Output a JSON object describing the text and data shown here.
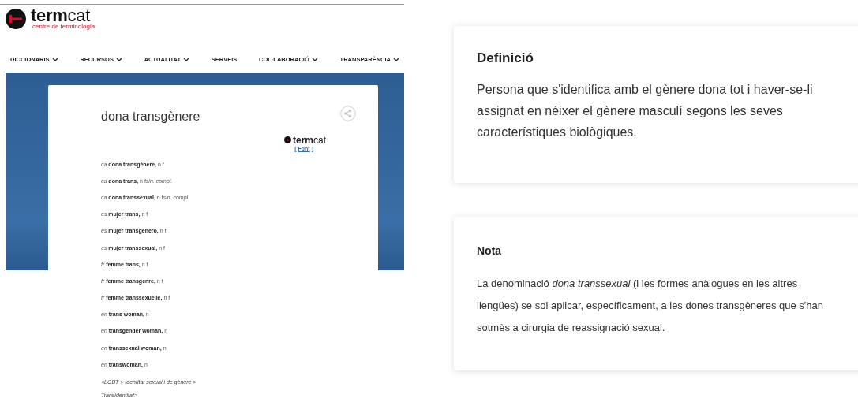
{
  "logo": {
    "name": "**term**cat",
    "tagline": "centre de terminologia"
  },
  "nav": [
    {
      "label": "DICCIONARIS",
      "dropdown": true
    },
    {
      "label": "RECURSOS",
      "dropdown": true
    },
    {
      "label": "ACTUALITAT",
      "dropdown": true
    },
    {
      "label": "SERVEIS",
      "dropdown": false
    },
    {
      "label": "COL·LABORACIÓ",
      "dropdown": true
    },
    {
      "label": "TRANSPARÈNCIA",
      "dropdown": true
    }
  ],
  "term_card": {
    "title": "dona transgènere",
    "source_logo": "**term**cat",
    "source_open": "[",
    "source_link": "Font",
    "source_close": "]",
    "entries": [
      {
        "lang": "ca",
        "term": "dona transgènere,",
        "grammar": "n f"
      },
      {
        "lang": "ca",
        "term": "dona trans,",
        "grammar": "n f",
        "note": "sin. compl."
      },
      {
        "lang": "ca",
        "term": "dona transsexual,",
        "grammar": "n f",
        "note": "sin. compl."
      },
      {
        "lang": "es",
        "term": "mujer trans,",
        "grammar": "n f"
      },
      {
        "lang": "es",
        "term": "mujer transgénero,",
        "grammar": "n f"
      },
      {
        "lang": "es",
        "term": "mujer transsexual,",
        "grammar": "n f"
      },
      {
        "lang": "fr",
        "term": "femme trans,",
        "grammar": "n f"
      },
      {
        "lang": "fr",
        "term": "femme transgenre,",
        "grammar": "n f"
      },
      {
        "lang": "fr",
        "term": "femme transsexuelle,",
        "grammar": "n f"
      },
      {
        "lang": "en",
        "term": "trans woman,",
        "grammar": "n"
      },
      {
        "lang": "en",
        "term": "transgender woman,",
        "grammar": "n"
      },
      {
        "lang": "en",
        "term": "transsexual woman,",
        "grammar": "n"
      },
      {
        "lang": "en",
        "term": "transwoman,",
        "grammar": "n"
      }
    ],
    "category": "<LGBT > Identitat sexual i de gènere > Transidentitat>"
  },
  "definition": {
    "heading": "Definició",
    "text": "Persona que s'identifica amb el gènere dona tot i haver-se-li assignat en néixer el gènere masculí segons les seves característiques biològiques."
  },
  "note": {
    "heading": "Nota",
    "text": "La denominació *dona transsexual* (i les formes anàlogues en les altres llengües) se sol aplicar, específicament, a les dones transgèneres que s'han sotmès a cirurgia de reassignació sexual."
  }
}
